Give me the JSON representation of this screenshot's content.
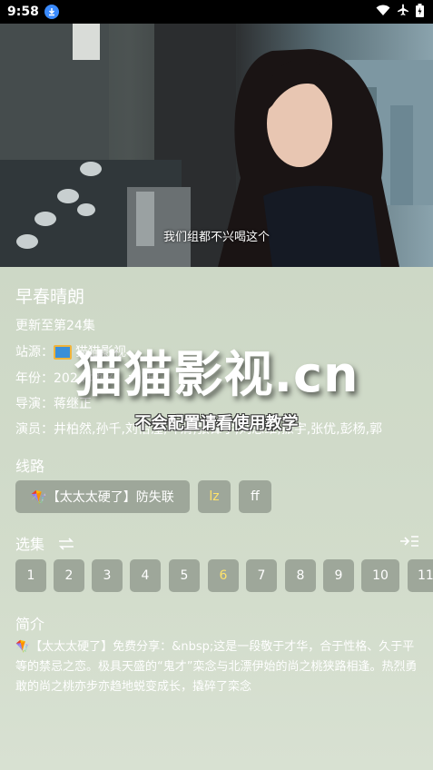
{
  "status_bar": {
    "time": "9:58"
  },
  "video": {
    "subtitle": "我们组都不兴喝这个"
  },
  "details": {
    "title": "早春晴朗",
    "update": "更新至第24集",
    "source_label": "站源：",
    "source_value": "猫猫影视",
    "year_label": "年份：",
    "year_value": "2024  地区：大陆",
    "director_label": "导演：",
    "director_value": "蒋继正",
    "cast_label": "演员：",
    "cast_value": "井柏然,孙千,刘怡潼,叶清,张锋宇,刘思维,振宇,张优,彭杨,郭"
  },
  "routes": {
    "heading": "线路",
    "items": [
      "🪁【太太太硬了】防失联",
      "lz",
      "ff"
    ],
    "active_index": 1
  },
  "episodes": {
    "heading": "选集",
    "items": [
      "1",
      "2",
      "3",
      "4",
      "5",
      "6",
      "7",
      "8",
      "9",
      "10",
      "11"
    ],
    "active_index": 5
  },
  "intro": {
    "heading": "简介",
    "text": "🪁【太太太硬了】免费分享：&nbsp;这是一段敬于才华，合于性格、久于平等的禁忌之恋。极具天盛的“鬼才”栾念与北漂伊始的尚之桃狭路相逢。热烈勇敢的尚之桃亦步亦趋地蜕变成长，撬碎了栾念"
  },
  "watermark": {
    "main": "猫猫影视.cn",
    "sub": "不会配置请看使用教学"
  }
}
